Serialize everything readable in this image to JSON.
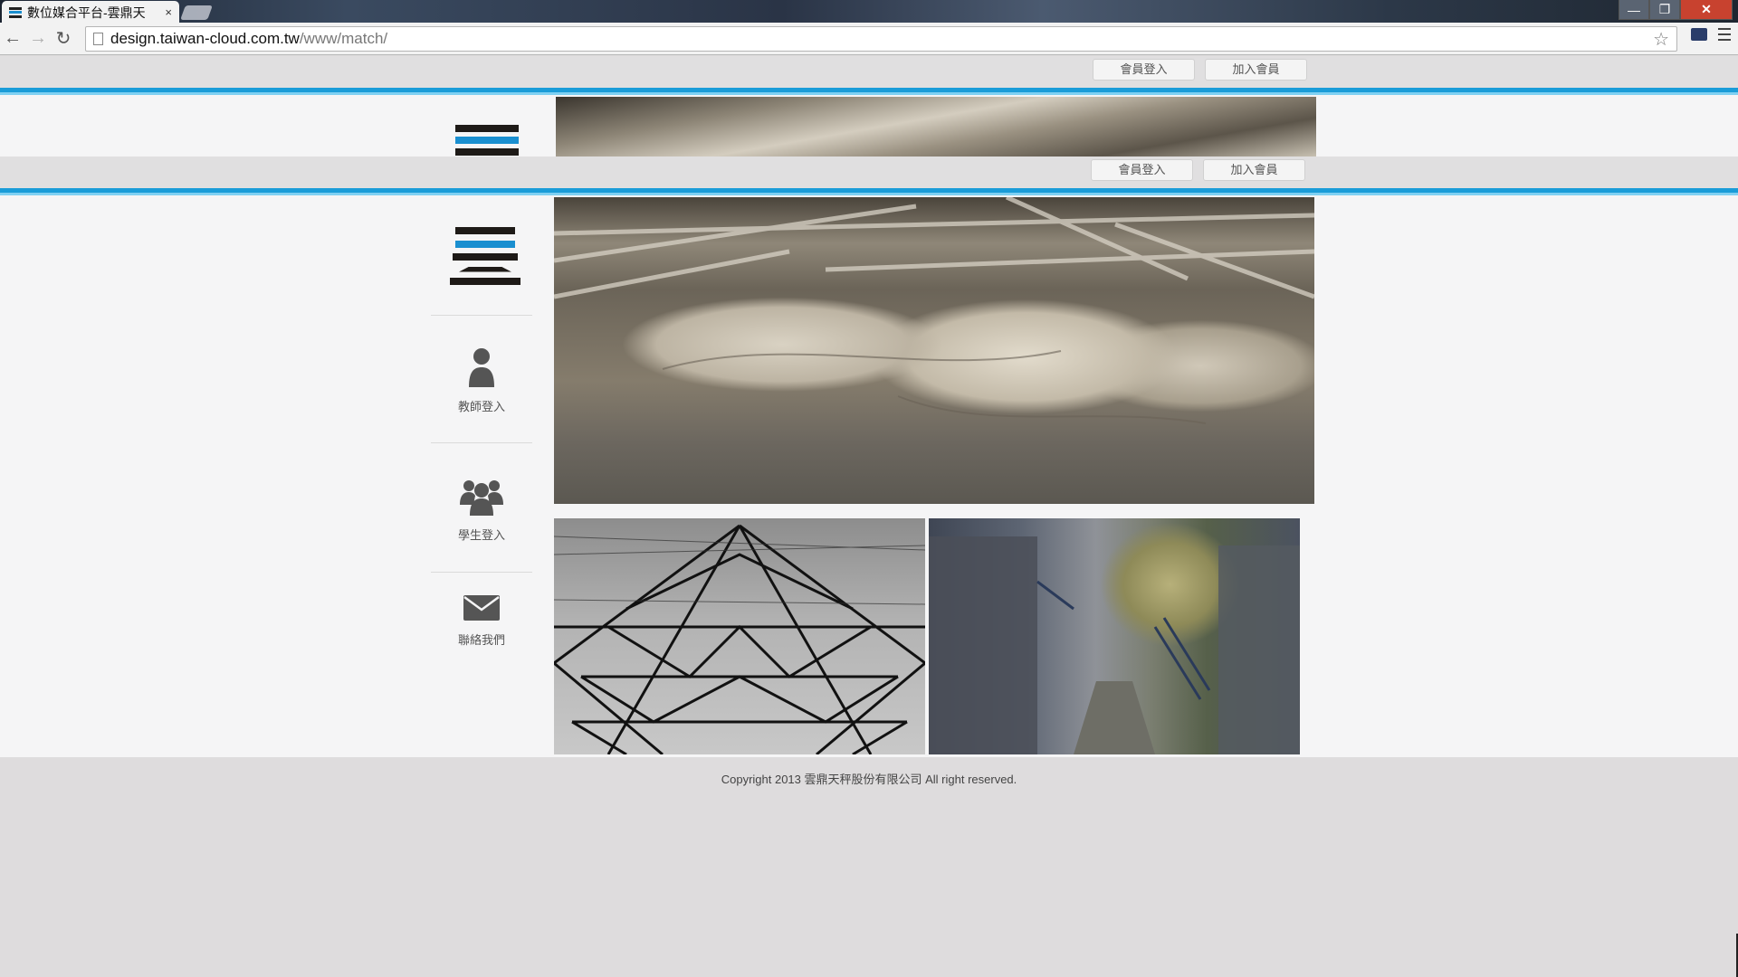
{
  "browser": {
    "tab_title": "數位媒合平台-雲鼎天",
    "tab_close": "×",
    "window_min": "—",
    "window_max": "❐",
    "window_close": "✕",
    "back": "←",
    "forward": "→",
    "reload": "↻",
    "url_host": "design.taiwan-cloud.com.tw",
    "url_path": "/www/match/",
    "star": "☆"
  },
  "header": {
    "member_login": "會員登入",
    "join_member": "加入會員"
  },
  "sidebar": {
    "teacher_login": "教師登入",
    "student_login": "學生登入",
    "contact_us": "聯絡我們"
  },
  "footer": {
    "copyright": "Copyright 2013 雲鼎天秤股份有限公司 All right reserved."
  },
  "colors": {
    "accent_blue": "#1a9cd8",
    "logo_dark": "#1e1a17",
    "page_bg": "#dedcdd",
    "content_bg": "#f5f5f6"
  }
}
